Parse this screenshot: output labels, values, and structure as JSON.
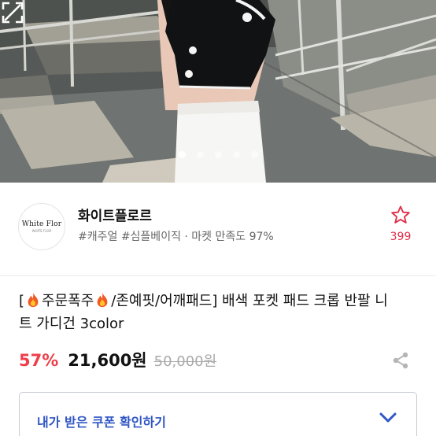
{
  "hero": {
    "pager": {
      "count": 5,
      "active_index": 0
    },
    "expand_icon": "expand-icon"
  },
  "shop": {
    "logo": {
      "line1": "White Flor",
      "line2": "WHITE FLOR"
    },
    "name": "화이트플로르",
    "tags": "#캐주얼 #심플베이직 · 마켓 만족도 97%",
    "favorite": {
      "icon": "star-icon",
      "count": "399",
      "color": "#e0304a"
    }
  },
  "product": {
    "title_parts": [
      "[",
      "주문폭주",
      "/존예핏/어깨패드] 배색 포켓 패드 크롭 반팔 니트 가디건 3color"
    ],
    "fire_icon": "fire-icon",
    "discount": "57%",
    "price": "21,600원",
    "original_price": "50,000원",
    "share_icon": "share-icon"
  },
  "coupon": {
    "label": "내가 받은 쿠폰 확인하기",
    "icon": "chevron-down-icon",
    "color": "#2f56c4"
  },
  "colors": {
    "discount": "#ee3e4a",
    "accent": "#2f56c4"
  }
}
